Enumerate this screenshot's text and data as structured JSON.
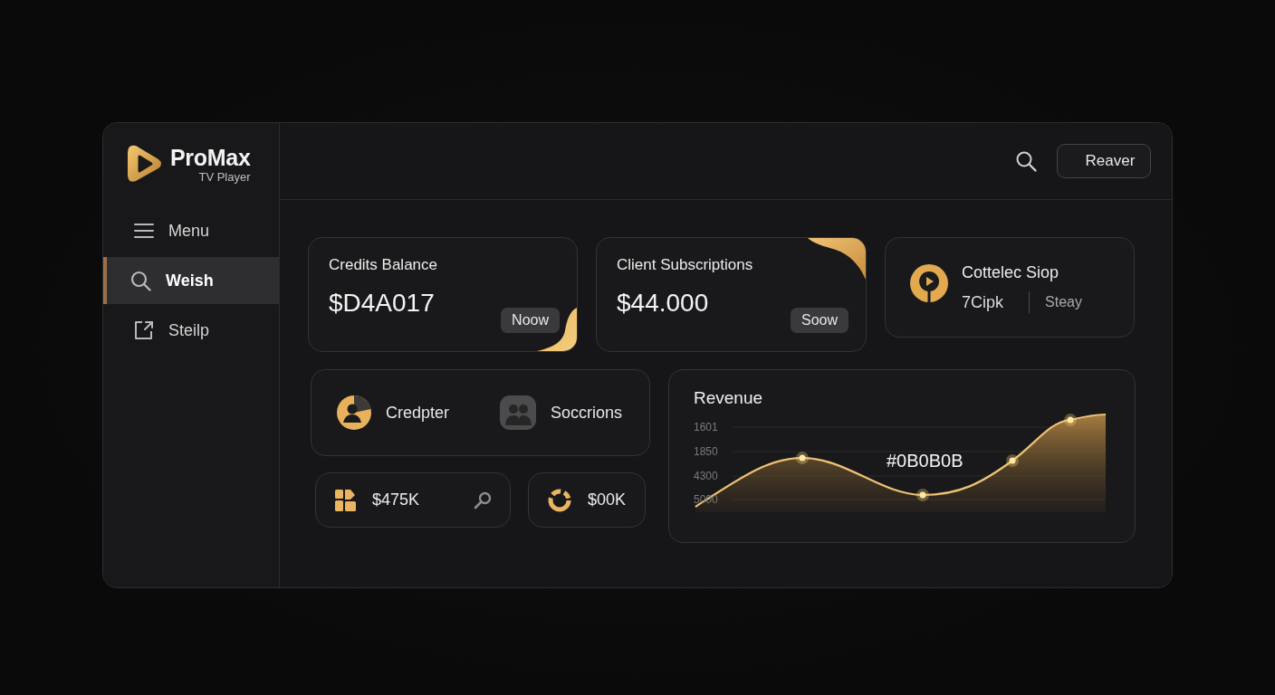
{
  "app": {
    "name": "ProMax",
    "subtitle": "TV Player"
  },
  "sidebar": {
    "items": [
      {
        "label": "Menu",
        "selected": false
      },
      {
        "label": "Weish",
        "selected": true
      },
      {
        "label": "Steilp",
        "selected": false
      }
    ]
  },
  "header": {
    "button": "Reaver"
  },
  "stat_cards": [
    {
      "title": "Credits Balance",
      "value": "$D4A017",
      "button": "Noow",
      "ornament_top": false,
      "ornament_bottom": true
    },
    {
      "title": "Client Subscriptions",
      "value": "$44.000",
      "button": "Soow",
      "ornament_top": true,
      "ornament_bottom": false
    }
  ],
  "profile_card": {
    "title": "Cottelec Siop",
    "value": "7Cipk",
    "status": "Steay"
  },
  "shortcuts": [
    {
      "label": "Credpter"
    },
    {
      "label": "Soccrions"
    }
  ],
  "mini_cards": [
    {
      "value": "$475K",
      "search": true
    },
    {
      "value": "$00K",
      "search": false
    }
  ],
  "revenue": {
    "title": "Revenue",
    "axis_labels": [
      "1601",
      "1850",
      "4300",
      "5000"
    ],
    "callout": "#0B0B0B"
  }
}
